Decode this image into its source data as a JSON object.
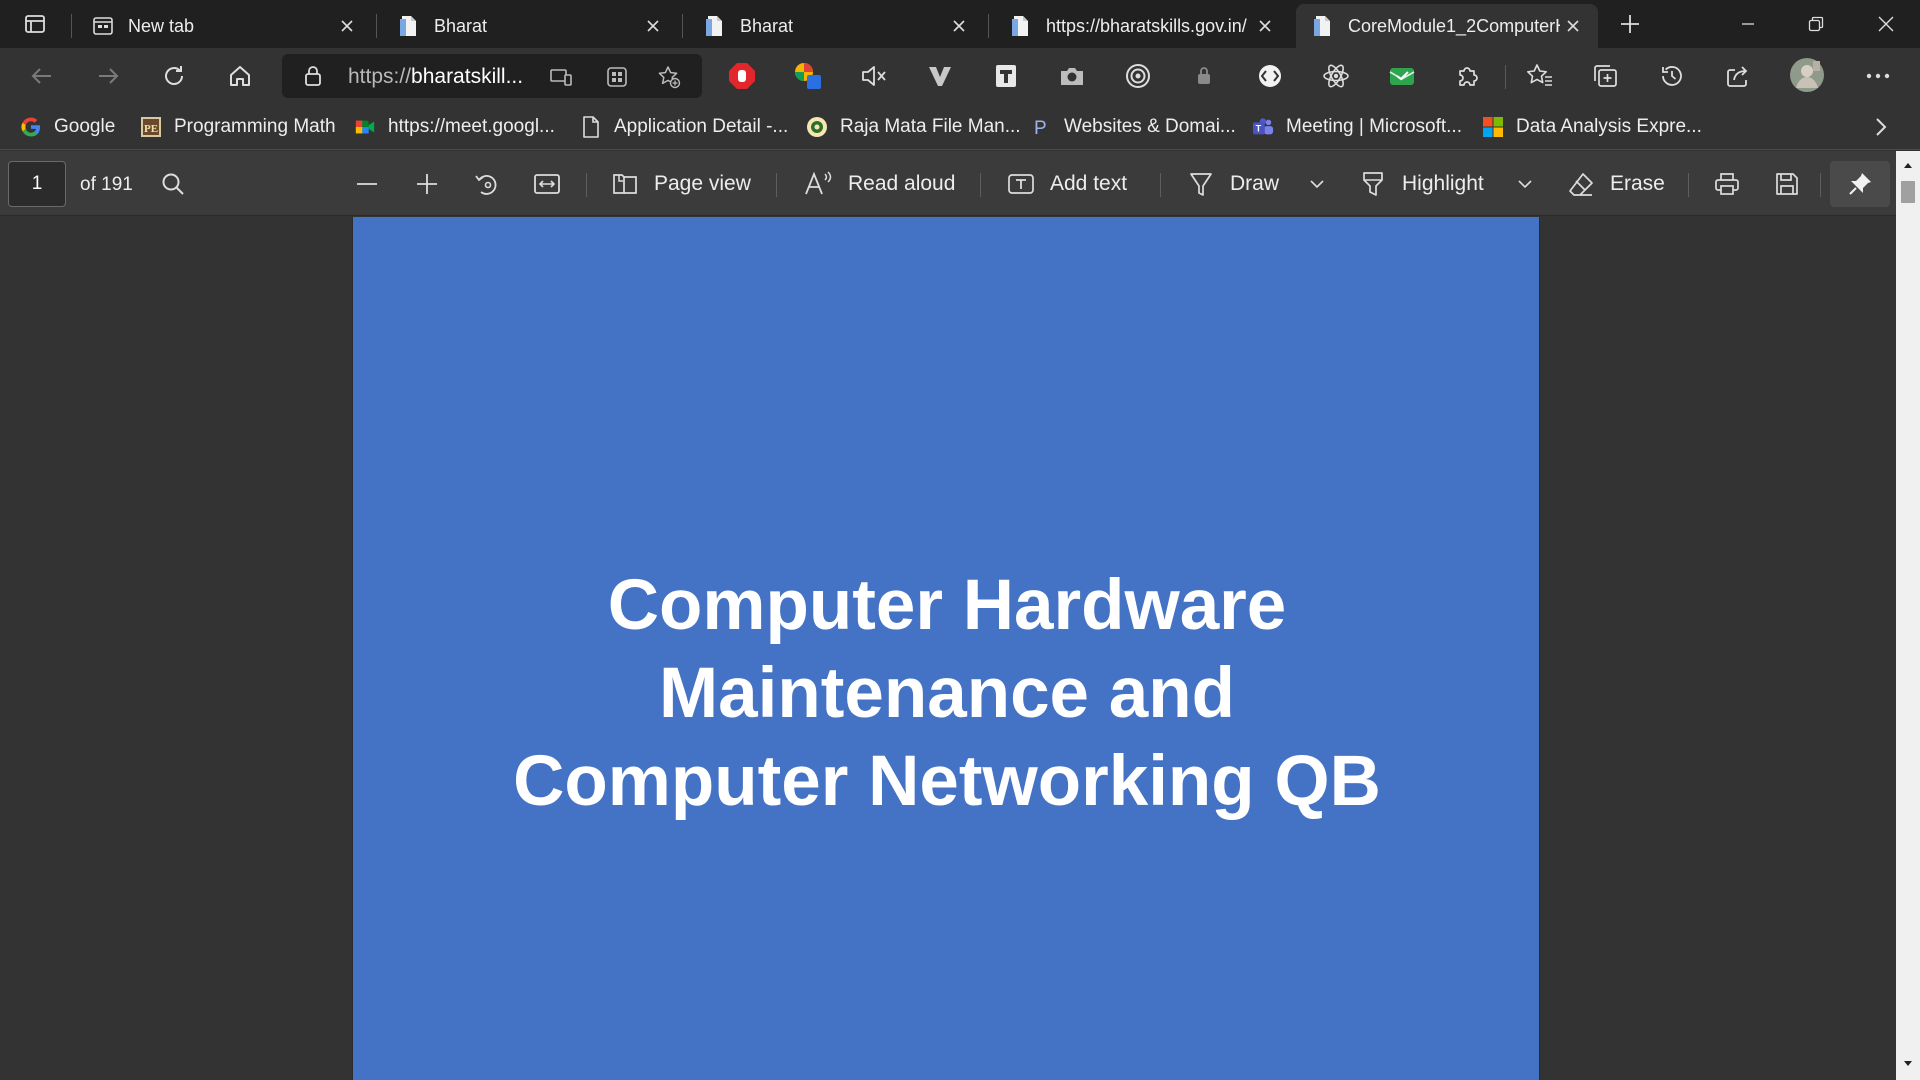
{
  "browser": {
    "tabs": [
      {
        "title": "New tab",
        "favicon": "new-tab-page-icon",
        "active": false
      },
      {
        "title": "Bharat",
        "favicon": "pdf-document-icon",
        "active": false
      },
      {
        "title": "Bharat",
        "favicon": "pdf-document-icon",
        "active": false
      },
      {
        "title": "https://bharatskills.gov.in/",
        "favicon": "pdf-document-icon",
        "active": false
      },
      {
        "title": "CoreModule1_2ComputerH",
        "favicon": "pdf-document-icon",
        "active": true
      }
    ],
    "address": {
      "prefix": "https://",
      "host": "bharatskill...",
      "secure": true
    },
    "favorites": [
      {
        "label": "Google",
        "icon": "google-icon"
      },
      {
        "label": "Programming Math",
        "icon": "pe-logo-icon"
      },
      {
        "label": "https://meet.googl...",
        "icon": "google-meet-icon"
      },
      {
        "label": "Application Detail -...",
        "icon": "page-icon"
      },
      {
        "label": "Raja Mata File Man...",
        "icon": "emblem-icon"
      },
      {
        "label": "Websites & Domai...",
        "icon": "p-logo-icon"
      },
      {
        "label": "Meeting | Microsoft...",
        "icon": "teams-icon"
      },
      {
        "label": "Data Analysis Expre...",
        "icon": "microsoft-logo-icon"
      }
    ],
    "colors": {
      "tabstrip": "#202020",
      "toolbar": "#333333",
      "pdf_toolbar": "#3b3b3b",
      "page_background": "#4472c4"
    }
  },
  "pdf_toolbar": {
    "page_number": "1",
    "page_total": "of 191",
    "page_view": "Page view",
    "read_aloud": "Read aloud",
    "add_text": "Add text",
    "draw": "Draw",
    "highlight": "Highlight",
    "erase": "Erase"
  },
  "document": {
    "title_lines": [
      "Computer Hardware",
      "Maintenance and",
      "Computer Networking QB"
    ]
  }
}
